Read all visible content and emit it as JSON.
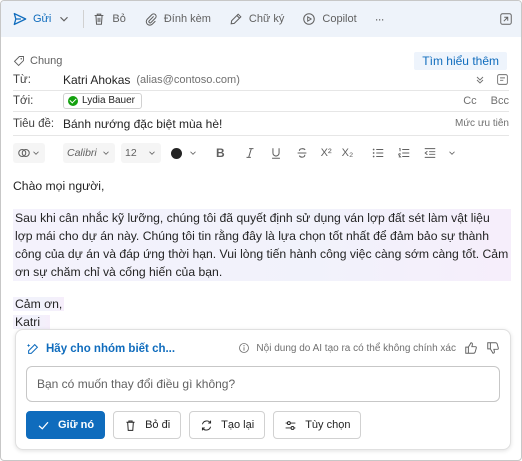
{
  "toolbar": {
    "send": "Gửi",
    "discard": "Bỏ",
    "attach": "Đính kèm",
    "signature": "Chữ ký",
    "copilot": "Copilot",
    "more": "···"
  },
  "sensitivity": {
    "label": "Chung",
    "learn_more": "Tìm hiểu thêm"
  },
  "from": {
    "label": "Từ:",
    "name": "Katri Ahokas",
    "alias": "(alias@contoso.com)"
  },
  "to": {
    "label": "Tới:",
    "recipient": "Lydia Bauer",
    "cc": "Cc",
    "bcc": "Bcc"
  },
  "subject": {
    "label": "Tiêu đề:",
    "value": "Bánh nướng đặc biệt mùa hè!",
    "priority": "Mức ưu tiên"
  },
  "format": {
    "font": "Calibri",
    "size": "12",
    "bold": "B",
    "superscript": "X²",
    "subscript": "X₂"
  },
  "body": {
    "greeting": "Chào mọi người,",
    "paragraph": "Sau khi cân nhắc kỹ lưỡng, chúng tôi đã quyết định sử dụng ván lợp đất sét làm vật liệu lợp mái cho dự án này. Chúng tôi tin rằng đây là lựa chọn tốt nhất để đảm bảo sự thành công của dự án và đáp ứng thời hạn. Vui lòng tiến hành công việc càng sớm càng tốt. Cảm ơn sự chăm chỉ và cống hiến của bạn.",
    "closing": "Cảm ơn,",
    "signature": "Katri"
  },
  "copilot_panel": {
    "title": "Hãy cho nhóm biết ch...",
    "disclaimer": "Nội dung do AI tạo ra có thể không chính xác",
    "input_placeholder": "Bạn có muốn thay đổi điều gì không?",
    "keep": "Giữ nó",
    "discard": "Bỏ đi",
    "regenerate": "Tạo lại",
    "options": "Tùy chọn"
  },
  "colors": {
    "accent": "#0f6cbd",
    "toolbar_bg": "#eef3fa",
    "presence_green": "#13a10e"
  }
}
